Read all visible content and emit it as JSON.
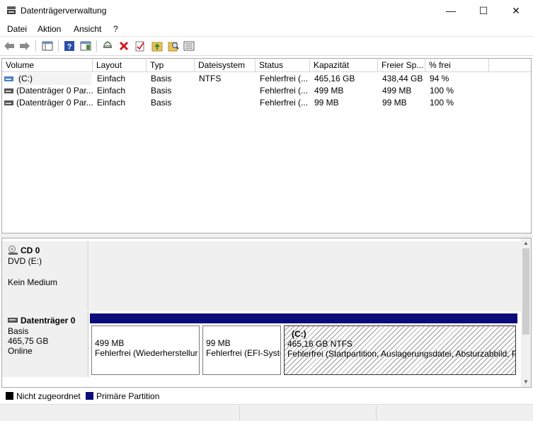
{
  "window": {
    "title": "Datenträgerverwaltung",
    "minimize_glyph": "—",
    "maximize_glyph": "☐",
    "close_glyph": "✕"
  },
  "menu": [
    "Datei",
    "Aktion",
    "Ansicht",
    "?"
  ],
  "toolbar": {
    "icons": [
      "back-arrow-icon",
      "forward-arrow-icon",
      "console-tree-icon",
      "help-icon",
      "action-pane-icon",
      "connect-disk-icon",
      "delete-icon",
      "properties-icon",
      "up-folder-icon",
      "find-icon",
      "details-view-icon"
    ]
  },
  "volume_list": {
    "columns": [
      "Volume",
      "Layout",
      "Typ",
      "Dateisystem",
      "Status",
      "Kapazität",
      "Freier Sp...",
      "% frei"
    ],
    "rows": [
      {
        "volume": "(C:)",
        "layout": "Einfach",
        "typ": "Basis",
        "dateisystem": "NTFS",
        "status": "Fehlerfrei (...",
        "kapazitaet": "465,16 GB",
        "frei": "438,44 GB",
        "prozent": "94 %"
      },
      {
        "volume": "(Datenträger 0 Par...",
        "layout": "Einfach",
        "typ": "Basis",
        "dateisystem": "",
        "status": "Fehlerfrei (...",
        "kapazitaet": "499 MB",
        "frei": "499 MB",
        "prozent": "100 %"
      },
      {
        "volume": "(Datenträger 0 Par...",
        "layout": "Einfach",
        "typ": "Basis",
        "dateisystem": "",
        "status": "Fehlerfrei (...",
        "kapazitaet": "99 MB",
        "frei": "99 MB",
        "prozent": "100 %"
      }
    ]
  },
  "disks": {
    "cd": {
      "name": "CD 0",
      "line1": "DVD (E:)",
      "line2": "Kein Medium"
    },
    "disk0": {
      "name": "Datenträger 0",
      "type": "Basis",
      "size": "465,75 GB",
      "state": "Online",
      "partitions": [
        {
          "size": "499 MB",
          "status": "Fehlerfrei (Wiederherstellur"
        },
        {
          "size": "99 MB",
          "status": "Fehlerfrei (EFI-Syste"
        },
        {
          "label": "(C:)",
          "size": "465,16 GB NTFS",
          "status": "Fehlerfrei (Startpartition, Auslagerungsdatei, Absturzabbild, P"
        }
      ]
    }
  },
  "legend": [
    {
      "label": "Nicht zugeordnet",
      "color": "#000000"
    },
    {
      "label": "Primäre Partition",
      "color": "#0b0b7a"
    }
  ]
}
